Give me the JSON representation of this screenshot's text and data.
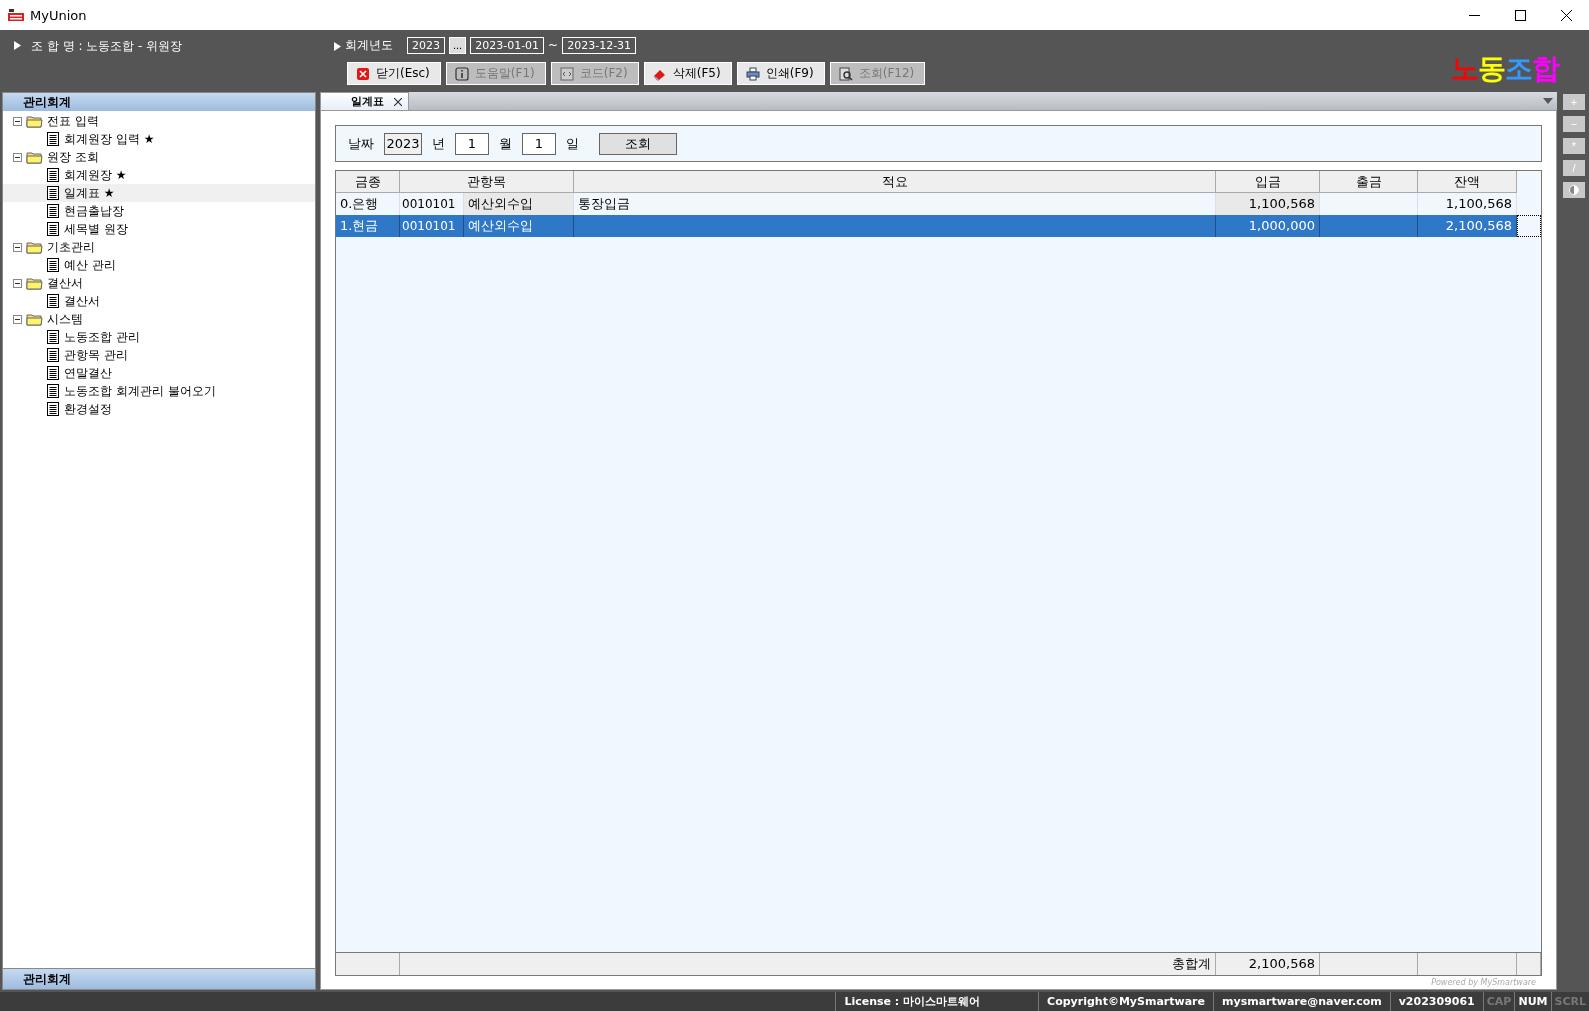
{
  "window": {
    "title": "MyUnion"
  },
  "header": {
    "union_label": "조 합 명 : 노동조합 - 위원장",
    "fiscal_label": "회계년도",
    "year": "2023",
    "picker_button": "...",
    "date_from": "2023-01-01",
    "separator": "~",
    "date_to": "2023-12-31"
  },
  "toolbar": [
    {
      "kind": "close",
      "label": "닫기(Esc)",
      "disabled": false
    },
    {
      "kind": "help",
      "label": "도움말(F1)",
      "disabled": true
    },
    {
      "kind": "code",
      "label": "코드(F2)",
      "disabled": true
    },
    {
      "kind": "delete",
      "label": "삭제(F5)",
      "disabled": false
    },
    {
      "kind": "print",
      "label": "인쇄(F9)",
      "disabled": false
    },
    {
      "kind": "search",
      "label": "조회(F12)",
      "disabled": true
    }
  ],
  "logo": [
    {
      "text": "노",
      "color": "#ff0000"
    },
    {
      "text": "동",
      "color": "#ffff00"
    },
    {
      "text": "조",
      "color": "#3399ff"
    },
    {
      "text": "합",
      "color": "#ff00ff"
    }
  ],
  "sidebar": {
    "title": "관리회계",
    "footer": "관리회계",
    "items": [
      {
        "label": "전표 입력",
        "expanded": true,
        "children": [
          {
            "label": "회계원장 입력 ★",
            "selected": false
          }
        ]
      },
      {
        "label": "원장 조회",
        "expanded": true,
        "children": [
          {
            "label": "회계원장 ★",
            "selected": false
          },
          {
            "label": "일계표 ★",
            "selected": true
          },
          {
            "label": "현금출납장",
            "selected": false
          },
          {
            "label": "세목별 원장",
            "selected": false
          }
        ]
      },
      {
        "label": "기초관리",
        "expanded": true,
        "children": [
          {
            "label": "예산 관리",
            "selected": false
          }
        ]
      },
      {
        "label": "결산서",
        "expanded": true,
        "children": [
          {
            "label": "결산서",
            "selected": false
          }
        ]
      },
      {
        "label": "시스템",
        "expanded": true,
        "children": [
          {
            "label": "노동조합 관리",
            "selected": false
          },
          {
            "label": "관항목 관리",
            "selected": false
          },
          {
            "label": "연말결산",
            "selected": false
          },
          {
            "label": "노동조합 회계관리 불어오기",
            "selected": false
          },
          {
            "label": "환경설정",
            "selected": false
          }
        ]
      }
    ]
  },
  "tabs": [
    {
      "label": "일계표",
      "selected": true
    }
  ],
  "filter": {
    "date_label": "날짜",
    "year": "2023",
    "year_unit": "년",
    "month": "1",
    "month_unit": "월",
    "day": "1",
    "day_unit": "일",
    "button": "조회"
  },
  "table": {
    "columns": [
      "금종",
      "관항목",
      "적요",
      "입금",
      "출금",
      "잔액"
    ],
    "rows": [
      {
        "selected": false,
        "fund": "0.은행",
        "account_code": "0010101",
        "account_name": "예산외수입",
        "memo": "통장입금",
        "deposit": "1,100,568",
        "balance": "1,100,568"
      },
      {
        "selected": true,
        "fund": "1.현금",
        "account_code": "0010101",
        "account_name": "예산외수입",
        "deposit": "1,000,000",
        "balance": "2,100,568"
      }
    ],
    "footer": {
      "label": "총합계",
      "total": "2,100,568"
    }
  },
  "powered_by": "Powered by MySmartware",
  "side_buttons": [
    "+",
    "−",
    "*",
    "/"
  ],
  "status_bar": {
    "license": "License : 마이스마트웨어",
    "copyright": "Copyright©MySmartware",
    "email": "mysmartware@naver.com",
    "version": "v202309061",
    "keys": [
      {
        "label": "CAP",
        "on": false
      },
      {
        "label": "NUM",
        "on": true
      },
      {
        "label": "SCRL",
        "on": false
      }
    ]
  }
}
